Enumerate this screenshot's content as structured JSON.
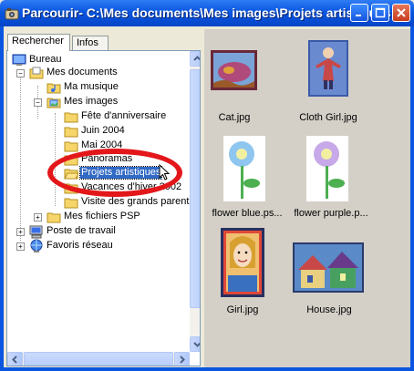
{
  "window": {
    "title": "Parcourir- C:\\Mes documents\\Mes images\\Projets artistiques"
  },
  "tabs": [
    {
      "label": "Rechercher"
    },
    {
      "label": "Infos"
    }
  ],
  "tree": {
    "items": [
      {
        "label": "Bureau",
        "icon": "desktop-icon"
      },
      {
        "label": "Mes documents",
        "icon": "my-documents-icon"
      },
      {
        "label": "Ma musique",
        "icon": "music-folder-icon"
      },
      {
        "label": "Mes images",
        "icon": "pictures-folder-icon"
      },
      {
        "label": "Fête d'anniversaire",
        "icon": "folder-icon"
      },
      {
        "label": "Juin 2004",
        "icon": "folder-icon"
      },
      {
        "label": "Mai 2004",
        "icon": "folder-icon"
      },
      {
        "label": "Panoramas",
        "icon": "folder-icon"
      },
      {
        "label": "Projets artistiques",
        "icon": "folder-icon"
      },
      {
        "label": "Vacances d'hiver 2002",
        "icon": "folder-icon"
      },
      {
        "label": "Visite des grands parents",
        "icon": "folder-icon"
      },
      {
        "label": "Mes fichiers PSP",
        "icon": "folder-icon"
      },
      {
        "label": "Poste de travail",
        "icon": "my-computer-icon"
      },
      {
        "label": "Favoris réseau",
        "icon": "network-icon"
      }
    ]
  },
  "thumbnails": [
    {
      "label": "Cat.jpg"
    },
    {
      "label": "Cloth Girl.jpg"
    },
    {
      "label": "flower blue.ps..."
    },
    {
      "label": "flower purple.p..."
    },
    {
      "label": "Girl.jpg"
    },
    {
      "label": "House.jpg"
    }
  ],
  "colors": {
    "titlebar": "#0a56e0",
    "selection": "#316ac5",
    "highlight_circle": "#e3171a",
    "thumbnail_panel": "#d4d0c8"
  }
}
